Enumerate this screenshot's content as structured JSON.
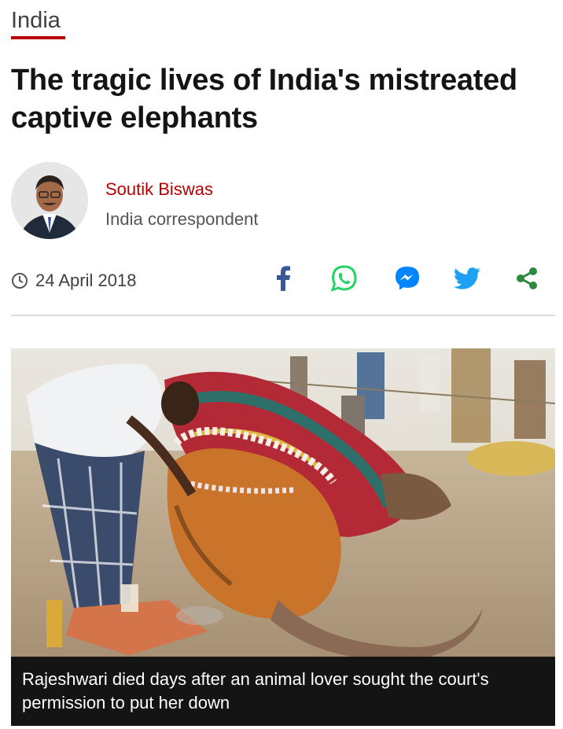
{
  "section": {
    "label": "India",
    "accent_color": "#b80000"
  },
  "article": {
    "headline": "The tragic lives of India's mistreated captive elephants",
    "author": {
      "name": "Soutik Biswas",
      "role": "India correspondent"
    },
    "date": "24 April 2018"
  },
  "share": {
    "items": [
      {
        "icon": "facebook-icon",
        "color": "#3b5998"
      },
      {
        "icon": "whatsapp-icon",
        "color": "#25d366"
      },
      {
        "icon": "messenger-icon",
        "color": "#0084ff"
      },
      {
        "icon": "twitter-icon",
        "color": "#1da1f2"
      },
      {
        "icon": "share-icon",
        "color": "#2b8a3e"
      }
    ]
  },
  "image": {
    "caption": "Rajeshwari died days after an animal lover sought the court's permission to put her down"
  }
}
